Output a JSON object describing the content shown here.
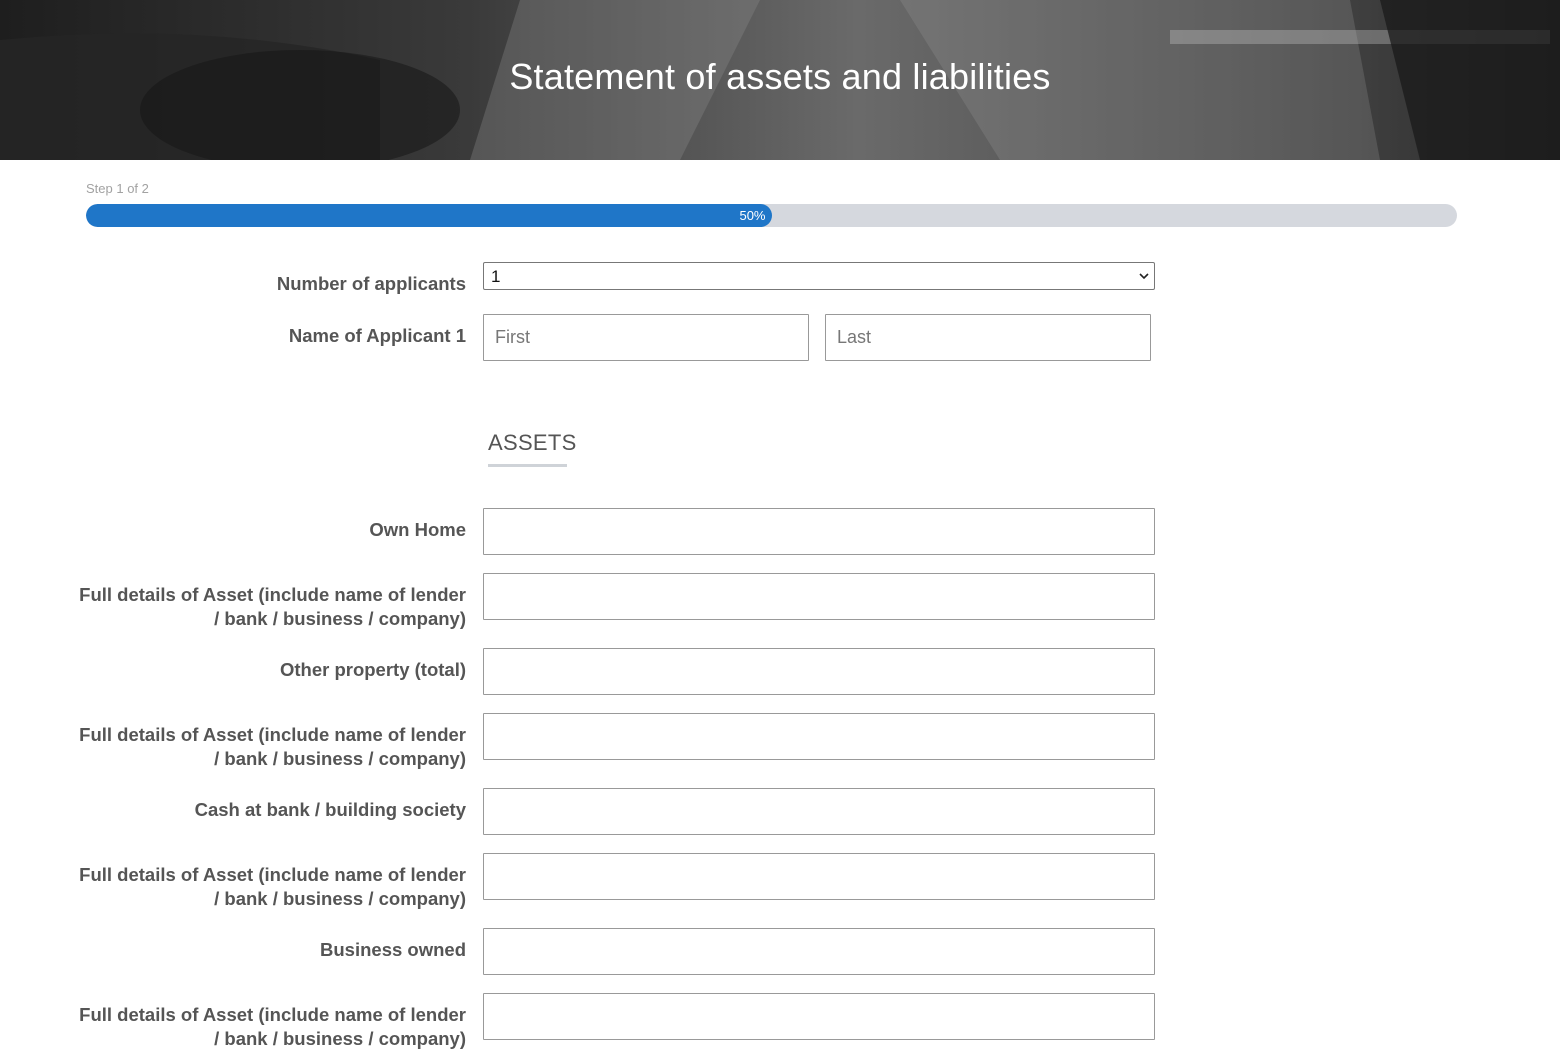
{
  "header": {
    "title": "Statement of assets and liabilities"
  },
  "progress": {
    "step_text": "Step 1 of 2",
    "percent_label": "50%",
    "fraction": 0.5,
    "fill_color": "#1f76c8",
    "track_color": "#d5d8de"
  },
  "applicants": {
    "count_label": "Number of applicants",
    "count_value": "1",
    "name_label": "Name of Applicant 1",
    "first_placeholder": "First",
    "last_placeholder": "Last"
  },
  "assets": {
    "heading": "ASSETS",
    "fields": [
      {
        "label": "Own Home"
      },
      {
        "label": "Full details of Asset (include name of lender / bank / business / company)"
      },
      {
        "label": "Other property (total)"
      },
      {
        "label": "Full details of Asset (include name of lender / bank / business / company)"
      },
      {
        "label": "Cash at bank / building society"
      },
      {
        "label": "Full details of Asset (include name of lender / bank / business / company)"
      },
      {
        "label": "Business owned"
      },
      {
        "label": "Full details of Asset (include name of lender / bank / business / company)"
      }
    ]
  }
}
